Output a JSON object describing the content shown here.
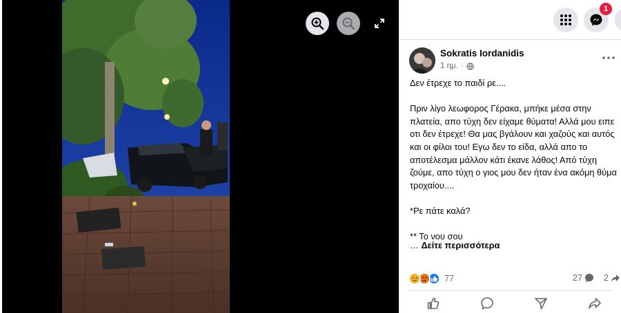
{
  "viewer": {
    "icons": {
      "zoom_in": "zoom-in-icon",
      "zoom_out": "zoom-out-icon",
      "expand": "expand-icon"
    }
  },
  "topbar": {
    "icons": {
      "menu": "grid-menu-icon",
      "messenger": "messenger-icon",
      "account": "account-icon"
    },
    "notification_count": "1"
  },
  "post": {
    "author": "Sokratis Iordanidis",
    "time": "1 ημ.",
    "audience_icon": "globe-icon",
    "text": "Δεν έτρεχε το παιδί ρε....\n\nΠριν λίγο λεωφορος Γέρακα, μπήκε μέσα στην πλατεία, απο τύχη δεν είχαμε θύματα! Αλλά μου ειπε οτι δεν έτρεχε! Θα μας βγάλουν και χαζούς και αυτός και οι φίλοι του! Εγω δεν το είδα, αλλά απο το αποτέλεσμα μάλλον κάτι έκανε λάθος! Από τύχη ζούμε, απο τύχη ο γιος μου δεν ήταν ένα ακόμη θύμα τροχαίου....\n\n*Ρε πάτε καλά?\n\n** Το νου σου",
    "see_more_prefix": "… ",
    "see_more": "Δείτε περισσότερα",
    "reactions": {
      "count": "77",
      "types": [
        "sad",
        "angry",
        "like"
      ],
      "colors": {
        "sad": "#f7b125",
        "angry": "#e9710f",
        "like": "#1877f2"
      }
    },
    "comments_count": "27",
    "shares_count": "2"
  },
  "actions": {
    "icons": [
      "like-icon",
      "comment-icon",
      "send-icon",
      "share-icon"
    ]
  },
  "colors": {
    "accent": "#1877f2",
    "badge": "#e41e3f",
    "secondary_text": "#65676b"
  }
}
